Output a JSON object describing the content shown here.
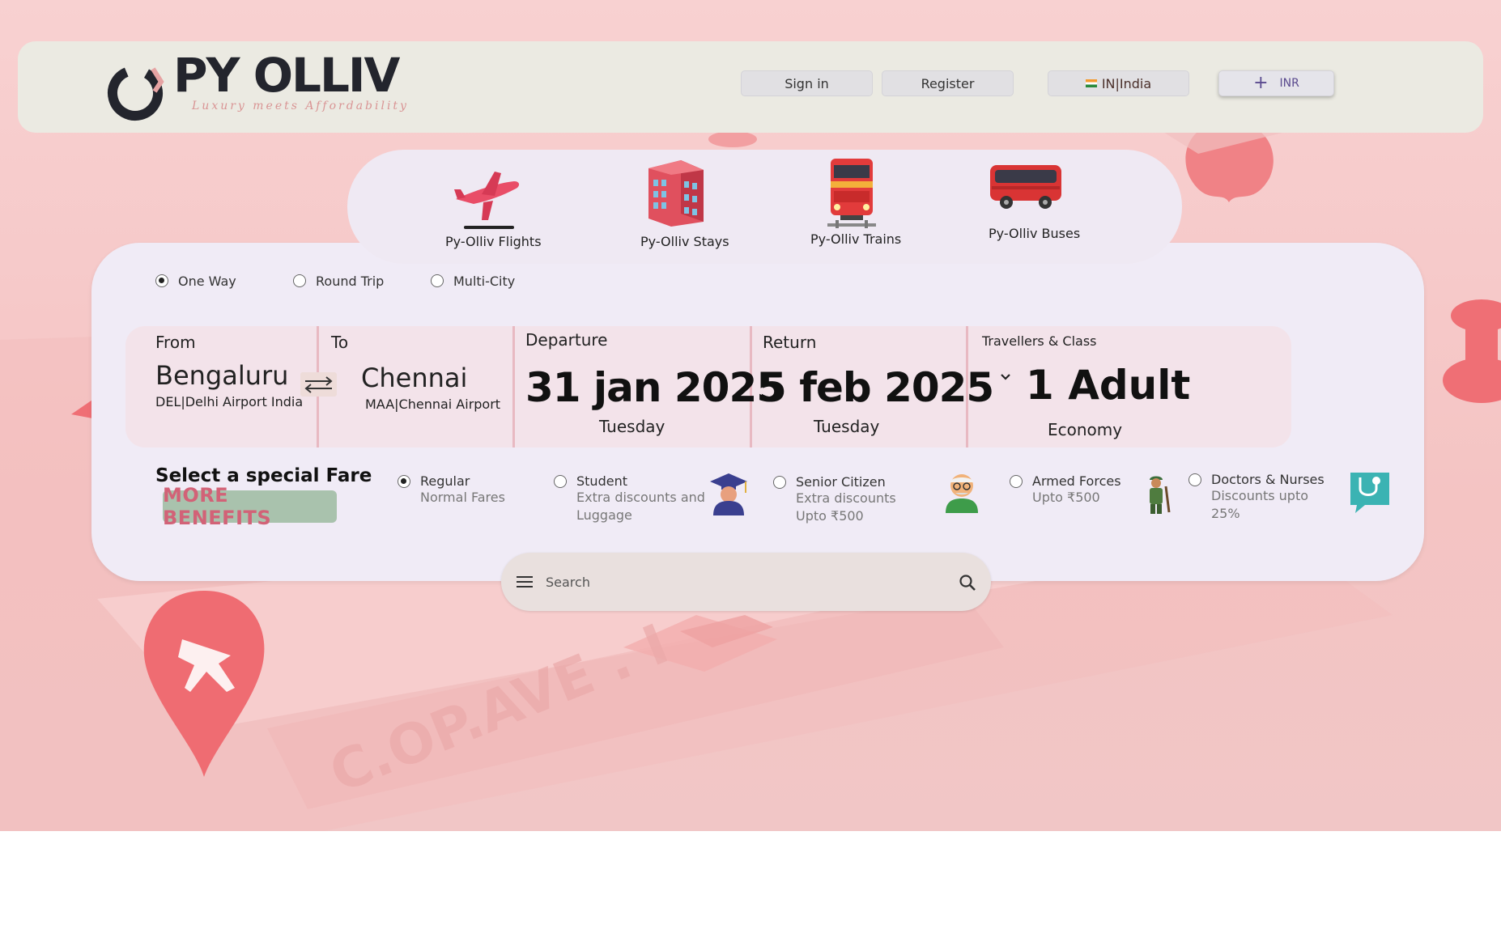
{
  "header": {
    "brand_title": "PY OLLIV",
    "brand_tagline": "Luxury meets Affordability",
    "sign_in_label": "Sign in",
    "register_label": "Register",
    "language_label": "IN|India",
    "currency_label": "INR"
  },
  "services": [
    {
      "label": "Py-Olliv Flights",
      "icon": "airplane-icon"
    },
    {
      "label": "Py-Olliv Stays",
      "icon": "hotel-icon"
    },
    {
      "label": "Py-Olliv Trains",
      "icon": "train-icon"
    },
    {
      "label": "Py-Olliv Buses",
      "icon": "bus-icon"
    }
  ],
  "trip_types": {
    "selected": "One Way",
    "options": [
      "One Way",
      "Round Trip",
      "Multi-City"
    ]
  },
  "search": {
    "from_label": "From",
    "from_city": "Bengaluru",
    "from_airport": "DEL|Delhi Airport India",
    "to_label": "To",
    "to_city": "Chennai",
    "to_airport": "MAA|Chennai Airport",
    "departure_label": "Departure",
    "departure_date": "31 jan 2025",
    "departure_day": "Tuesday",
    "return_label": "Return",
    "return_date": "5 feb 2025",
    "return_day": "Tuesday",
    "travellers_label": "Travellers & Class",
    "travellers_value": "1 Adult",
    "class_value": "Economy"
  },
  "fares": {
    "title": "Select a special Fare",
    "benefits_label": "MORE BENEFITS",
    "selected": "Regular",
    "options": [
      {
        "title": "Regular",
        "desc": "Normal Fares",
        "icon": ""
      },
      {
        "title": "Student",
        "desc": "Extra discounts and Luggage",
        "icon": "graduate-icon"
      },
      {
        "title": "Senior Citizen",
        "desc": "Extra discounts Upto ₹500",
        "icon": "senior-icon"
      },
      {
        "title": "Armed Forces",
        "desc": "Upto ₹500",
        "icon": "soldier-icon"
      },
      {
        "title": "Doctors & Nurses",
        "desc": "Discounts upto 25%",
        "icon": "stethoscope-icon"
      }
    ]
  },
  "searchbar": {
    "placeholder": "Search"
  },
  "colors": {
    "header_bg": "#ebeae2",
    "card_bg": "#f0ebf6",
    "panel_bg": "#f3e3ea",
    "benefits_bg": "#a9c2ad",
    "benefits_text": "#d26277"
  }
}
